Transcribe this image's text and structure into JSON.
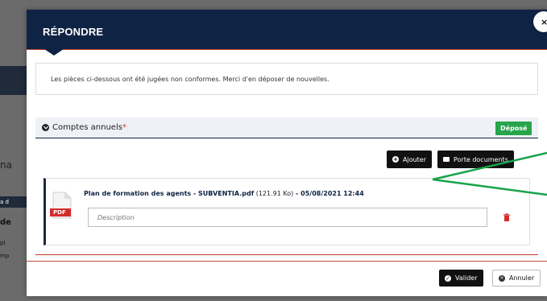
{
  "background": {
    "fragments": [
      "na",
      "a d",
      "de",
      "pl",
      "mp"
    ]
  },
  "modal": {
    "title": "RÉPONDRE",
    "close_label": "×",
    "notice": "Les pièces ci-dessous ont été jugées non conformes. Merci d'en déposer de nouvelles.",
    "section": {
      "title": "Comptes annuels",
      "required_mark": "*",
      "status_badge": "Déposé"
    },
    "actions": {
      "add_label": "Ajouter",
      "portfolio_label": "Porte documents"
    },
    "file": {
      "name": "Plan de formation des agents - SUBVENTIA.pdf",
      "size": "(121.91 Ko)",
      "separator": " - ",
      "date": "05/08/2021 12:44",
      "type_label": "PDF",
      "description_placeholder": "Description"
    },
    "footer": {
      "validate_label": "Valider",
      "cancel_label": "Annuler"
    }
  },
  "colors": {
    "header": "#0f2344",
    "accent_red": "#c0392b",
    "badge_green": "#27a54b",
    "annotation_green": "#17a34a"
  }
}
